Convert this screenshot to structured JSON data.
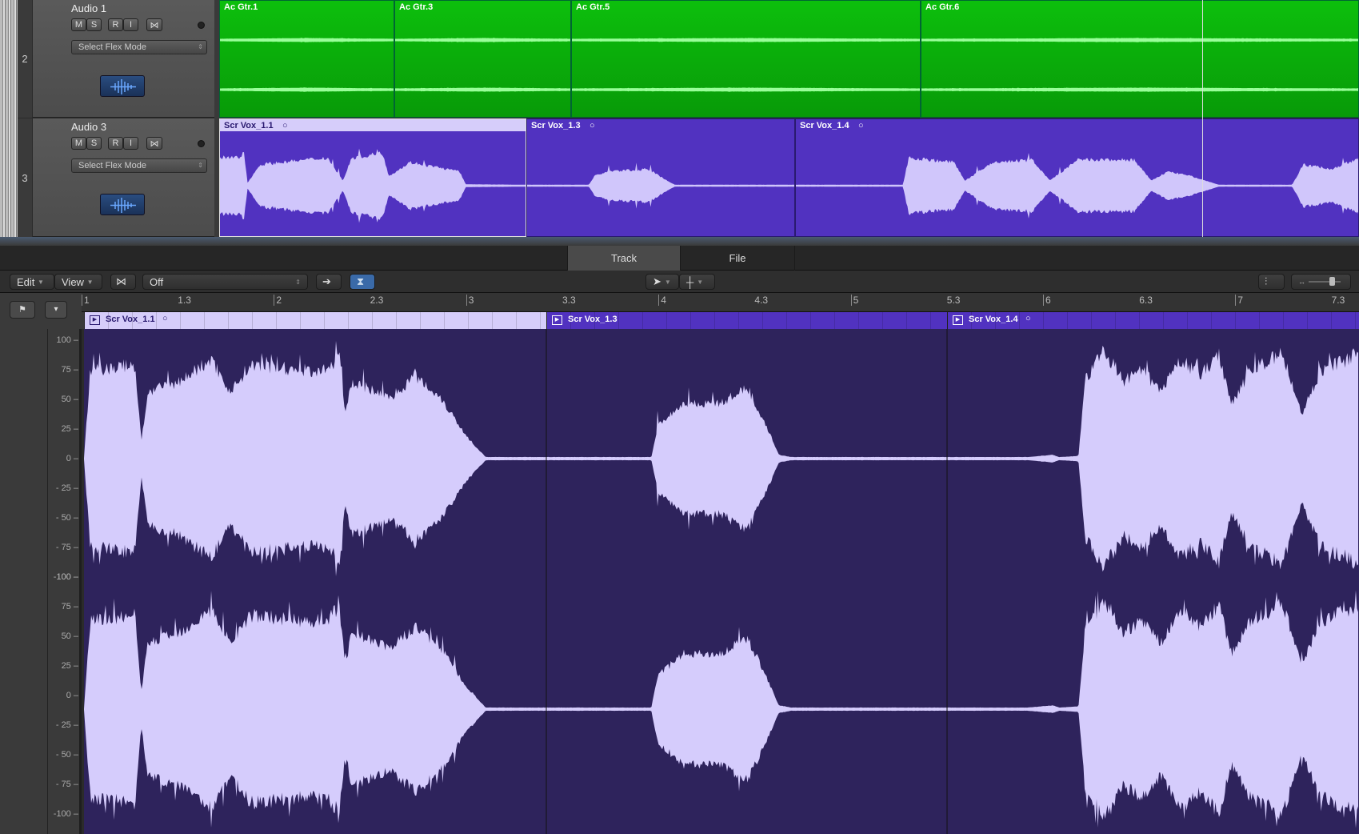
{
  "tracks": [
    {
      "number": "2",
      "name": "Audio 1",
      "buttons": [
        "M",
        "S",
        "R",
        "I"
      ],
      "flex_mode": "Select Flex Mode",
      "regions": [
        {
          "name": "Ac Gtr.1"
        },
        {
          "name": "Ac Gtr.3"
        },
        {
          "name": "Ac Gtr.5"
        },
        {
          "name": "Ac Gtr.6"
        }
      ],
      "color": "#0bb50b"
    },
    {
      "number": "3",
      "name": "Audio 3",
      "buttons": [
        "M",
        "S",
        "R",
        "I"
      ],
      "flex_mode": "Select Flex Mode",
      "regions": [
        {
          "name": "Scr Vox_1.1",
          "selected": true
        },
        {
          "name": "Scr Vox_1.3"
        },
        {
          "name": "Scr Vox_1.4"
        }
      ],
      "color": "#5132c0"
    }
  ],
  "tabs": [
    "Track",
    "File"
  ],
  "toolbar": {
    "edit": "Edit",
    "view": "View",
    "flex_value": "Off"
  },
  "ruler": [
    "1",
    "1.3",
    "2",
    "2.3",
    "3",
    "3.3",
    "4",
    "4.3",
    "5",
    "5.3",
    "6",
    "6.3",
    "7",
    "7.3"
  ],
  "editor_regions": [
    {
      "name": "Scr Vox_1.1"
    },
    {
      "name": "Scr Vox_1.3"
    },
    {
      "name": "Scr Vox_1.4"
    }
  ],
  "amplitude_scale": [
    "100",
    "75",
    "50",
    "25",
    "0",
    "- 25",
    "- 50",
    "- 75",
    "-100"
  ]
}
